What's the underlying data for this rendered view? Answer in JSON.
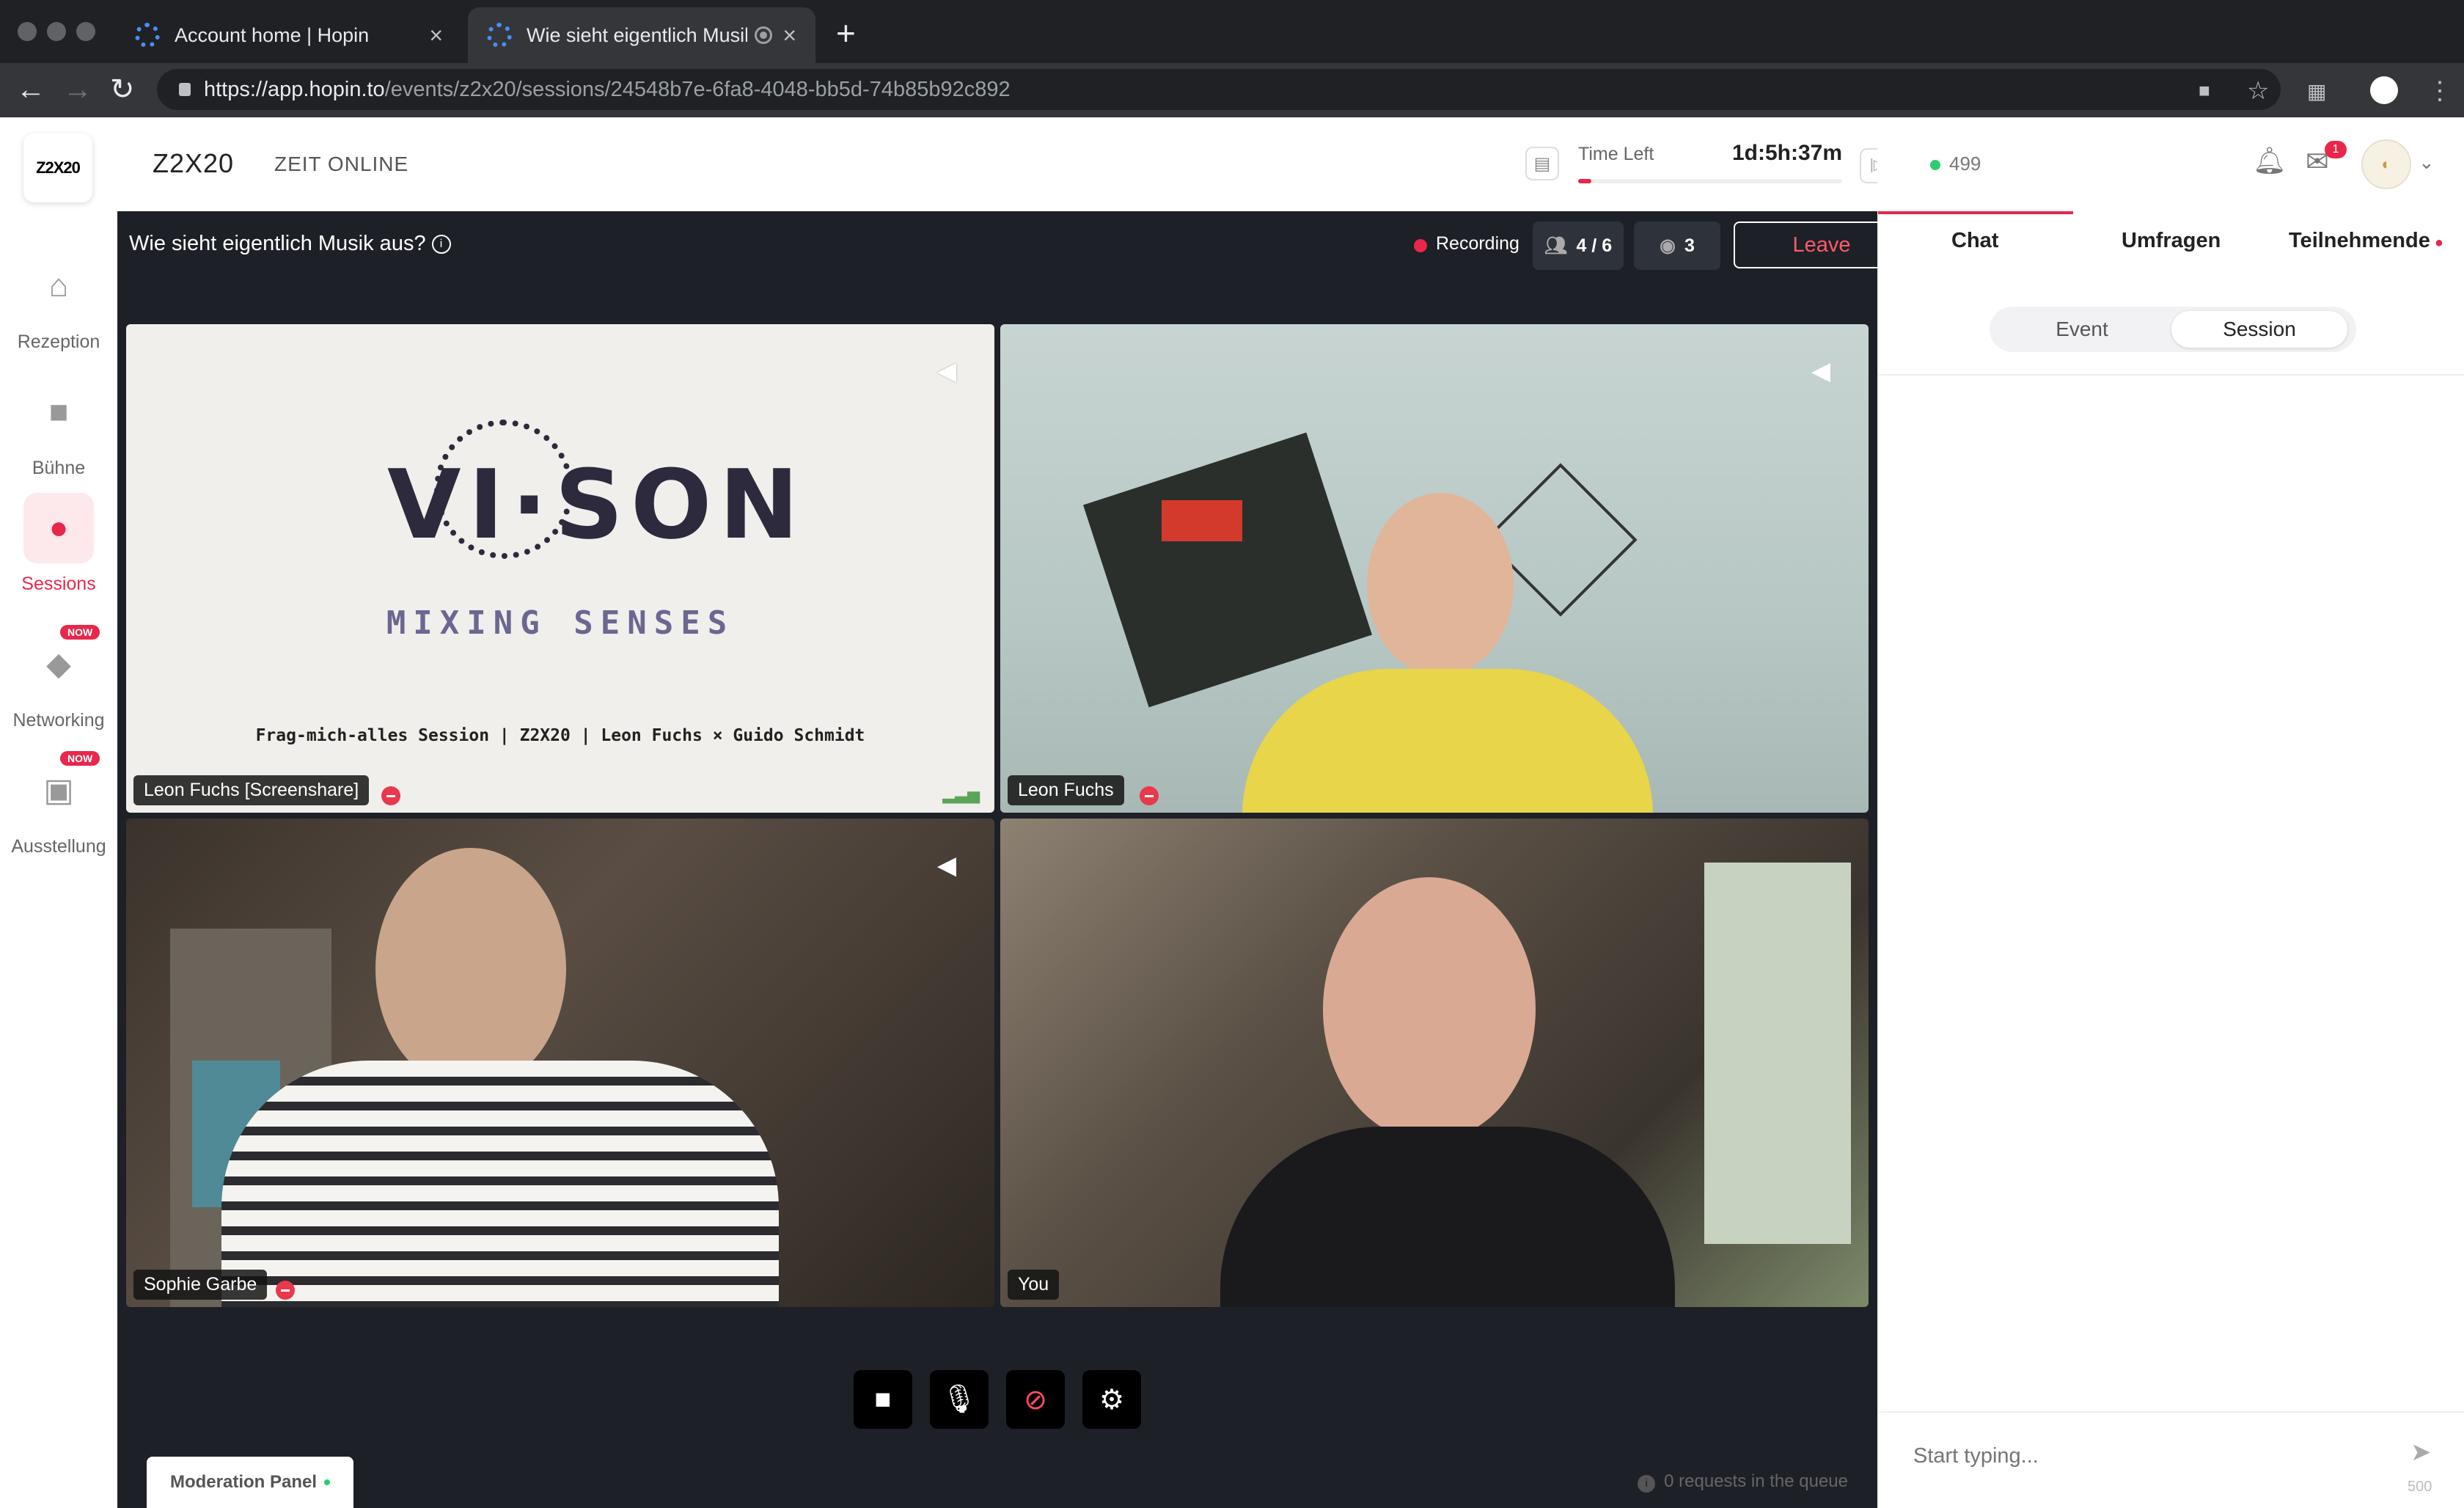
{
  "browser": {
    "tabs": [
      {
        "title": "Account home | Hopin"
      },
      {
        "title": "Wie sieht eigentlich Musik aus?"
      }
    ],
    "url_host": "https://app.hopin.to",
    "url_path": "/events/z2x20/sessions/24548b7e-6fa8-4048-bb5d-74b85b92c892"
  },
  "header": {
    "logo_text": "Z2X20",
    "event_title": "Z2X20",
    "organizer": "ZEIT ONLINE",
    "time_left_label": "Time Left",
    "time_left_value": "1d:5h:37m",
    "time_left_progress": 0.05,
    "online_count": "499",
    "mail_badge": "1"
  },
  "sidebar": {
    "items": [
      {
        "label": "Rezeption",
        "icon": "home-icon"
      },
      {
        "label": "Bühne",
        "icon": "camera-icon"
      },
      {
        "label": "Sessions",
        "icon": "people-icon",
        "active": true
      },
      {
        "label": "Networking",
        "icon": "handshake-icon",
        "badge": "NOW"
      },
      {
        "label": "Ausstellung",
        "icon": "booth-icon",
        "badge": "NOW"
      }
    ]
  },
  "session": {
    "title": "Wie sieht eigentlich Musik aus?",
    "recording_label": "Recording",
    "participants": "4 / 6",
    "viewers": "3",
    "leave_label": "Leave",
    "tiles": [
      {
        "name": "Leon Fuchs [Screenshare]",
        "muted": true
      },
      {
        "name": "Leon Fuchs",
        "muted": true
      },
      {
        "name": "Sophie Garbe",
        "muted": true
      },
      {
        "name": "You",
        "muted": false
      }
    ],
    "screenshare": {
      "logo": "VI·SON",
      "tagline": "MIXING SENSES",
      "caption": "Frag-mich-alles Session | Z2X20 | Leon Fuchs × Guido Schmidt"
    },
    "moderation_label": "Moderation Panel",
    "queue_text": "0 requests in the queue"
  },
  "right_panel": {
    "tabs": [
      "Chat",
      "Umfragen",
      "Teilnehmende"
    ],
    "segments": [
      "Event",
      "Session"
    ],
    "chat_placeholder": "Start typing...",
    "char_count": "500"
  },
  "colors": {
    "accent": "#e8274b",
    "stage_bg": "#1d2026",
    "online": "#2ecc71"
  }
}
